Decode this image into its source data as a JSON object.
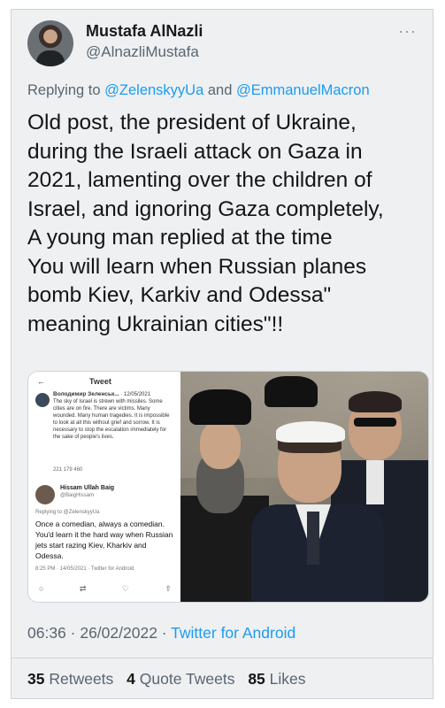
{
  "tweet": {
    "author_name": "Mustafa AlNazli",
    "author_handle": "@AlnazliMustafa",
    "more_icon": "···",
    "replying_prefix": "Replying to",
    "mention_1": "@ZelenskyyUa",
    "mention_join": "and",
    "mention_2": "@EmmanuelMacron",
    "body_lines": [
      "Old post, the president of Ukraine,",
      "during the Israeli attack on Gaza in",
      "2021, lamenting over the children of",
      "Israel, and ignoring Gaza completely,",
      "A young man replied at the time",
      " You will learn when Russian planes",
      "bomb Kiev, Karkiv and Odessa\"",
      "meaning  Ukrainian cities\"!!"
    ],
    "timestamp": "06:36 · 26/02/2022 ·",
    "source": "Twitter for Android",
    "retweets_count": "35",
    "retweets_label": "Retweets",
    "quote_count": "4",
    "quote_label": "Quote Tweets",
    "likes_count": "85",
    "likes_label": "Likes"
  },
  "embedded_screenshot": {
    "back_icon": "←",
    "header": "Tweet",
    "original_author": "Володимир Зеленськ...",
    "original_date": "· 12/05/2021",
    "original_text": "The sky of Israel is strewn with missiles. Some cities are on fire. There are victims. Many wounded. Many human tragedies. It is impossible to look at all this without grief and sorrow. It is necessary to stop the escalation immediately for the sake of people's lives.",
    "original_stats": "221   179   460",
    "reply_name": "Hissam Ullah Baig",
    "reply_handle": "@BaigHissam",
    "reply_to": "Replying to @ZelenskyyUa",
    "reply_text": "Once a comedian, always a comedian. You'd learn it the hard way when Russian jets start razing Kiev, Kharkiv and Odessa.",
    "reply_time": "8:25 PM · 14/05/2021 · Twitter for Android",
    "icons": [
      "comment-icon",
      "retweet-icon",
      "like-icon",
      "share-icon"
    ]
  }
}
